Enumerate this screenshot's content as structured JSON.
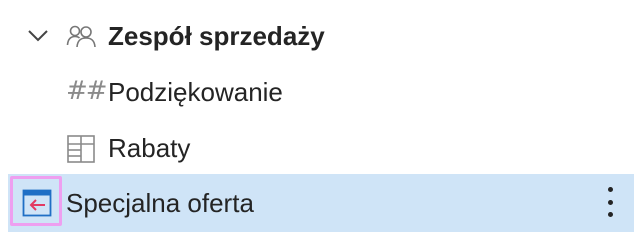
{
  "tree": {
    "group": {
      "label": "Zespół sprzedaży",
      "expanded": true,
      "icon": "people-icon",
      "chevron_icon": "chevron-down-icon"
    },
    "items": [
      {
        "label": "Podziękowanie",
        "icon": "hash-icon",
        "icon_text": "##"
      },
      {
        "label": "Rabaty",
        "icon": "table-icon"
      },
      {
        "label": "Specjalna oferta",
        "icon": "calendar-arrow-icon",
        "selected": true,
        "more_icon": "more-vertical-icon"
      }
    ]
  },
  "colors": {
    "selected_bg": "#cfe4f7",
    "focus_outline": "#ee9ff0",
    "icon_accent": "#e23a63",
    "icon_blue": "#1f6fc5",
    "text": "#242424",
    "muted_icon": "#8a8a8a"
  }
}
